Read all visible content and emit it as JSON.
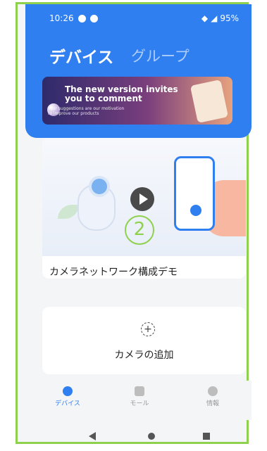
{
  "status_bar": {
    "time": "10:26",
    "battery": "95%"
  },
  "header": {
    "tab_devices": "デバイス",
    "tab_groups": "グループ",
    "add_label": "+"
  },
  "banner": {
    "line1": "The new version invites",
    "line2": "you to comment",
    "subline1": "Your suggestions are our motivation",
    "subline2": "to improve our products"
  },
  "demo_card": {
    "step_badge": "2",
    "label": "カメラネットワーク構成デモ"
  },
  "add_card": {
    "icon": "+",
    "label": "カメラの追加"
  },
  "bottom_nav": [
    {
      "label": "デバイス",
      "icon": "camera-icon",
      "active": true
    },
    {
      "label": "モール",
      "icon": "shop-icon",
      "active": false
    },
    {
      "label": "情報",
      "icon": "user-icon",
      "active": false
    }
  ],
  "colors": {
    "accent": "#2f7ff0",
    "frame": "#8fd14f"
  }
}
